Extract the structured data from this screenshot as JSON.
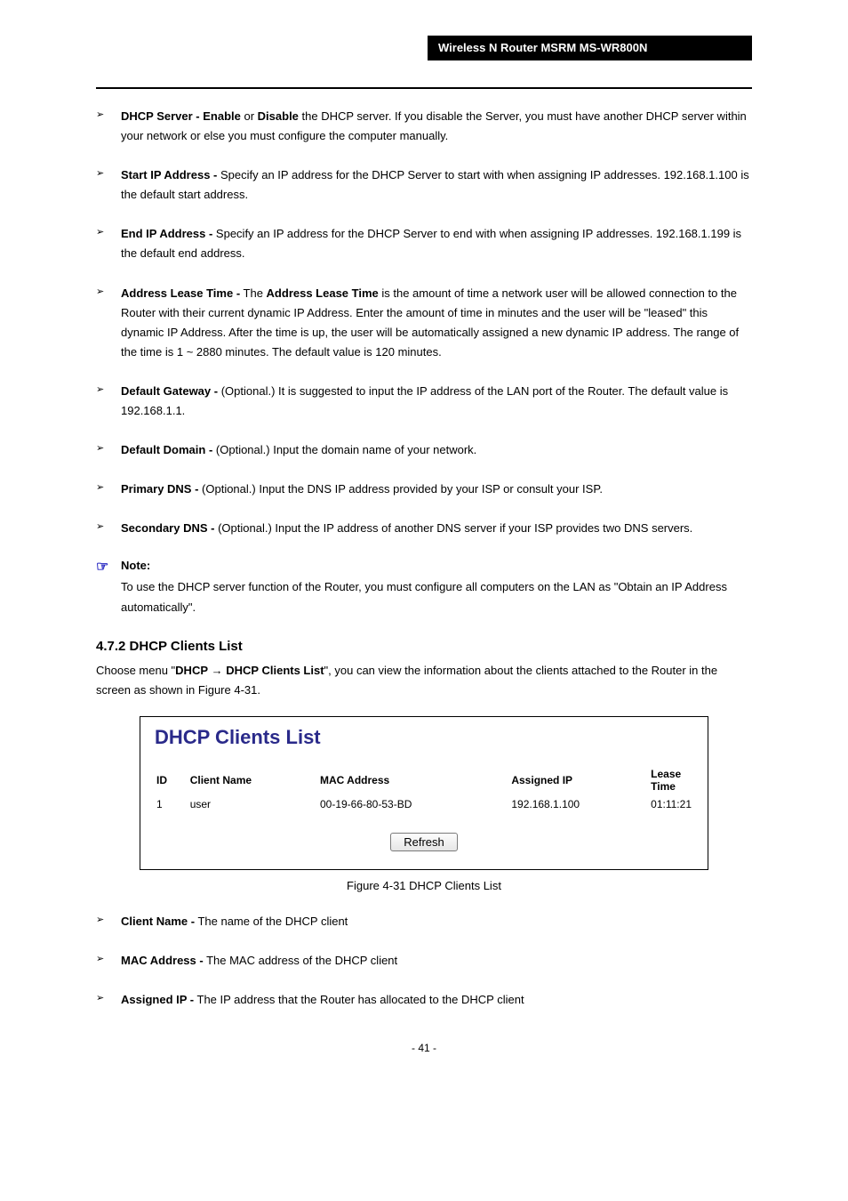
{
  "header": {
    "product": "Wireless N Router MSRM MS-WR800N",
    "page_number": "- 41 -"
  },
  "dhcp_settings": {
    "items": [
      {
        "term": "DHCP Server - Enable",
        "term_suffix": " or ",
        "term2": "Disable",
        "desc": " the DHCP server. If you disable the Server, you must have another DHCP server within your network or else you must configure the computer manually."
      },
      {
        "term": "Start IP Address -",
        "desc": " Specify an IP address for the DHCP Server to start with when assigning IP addresses. 192.168.1.100 is the default start address."
      },
      {
        "term": "End IP Address -",
        "desc": " Specify an IP address for the DHCP Server to end with when assigning IP addresses. 192.168.1.199 is the default end address."
      },
      {
        "term": "Address Lease Time -",
        "desc": " The ",
        "term_inner": "Address Lease Time",
        "desc2": " is the amount of time a network user will be allowed connection to the Router with their current dynamic IP Address. Enter the amount of time in minutes and the user will be \"leased\" this dynamic IP Address. After the time is up, the user will be automatically assigned a new dynamic IP address. The range of the time is 1 ~ 2880 minutes. The default value is 120 minutes."
      },
      {
        "term": "Default Gateway -",
        "desc": " (Optional.) It is suggested to input the IP address of the LAN port of the Router. The default value is 192.168.1.1."
      },
      {
        "term": "Default Domain -",
        "desc": " (Optional.) Input the domain name of your network."
      },
      {
        "term": "Primary DNS -",
        "desc": " (Optional.) Input the DNS IP address provided by your ISP or consult your ISP."
      },
      {
        "term": "Secondary DNS -",
        "desc": " (Optional.) Input the IP address of another DNS server if your ISP provides two DNS servers."
      }
    ],
    "note_label": "Note:",
    "note_text": "To use the DHCP server function of the Router, you must configure all computers on the LAN as \"Obtain an IP Address automatically\"."
  },
  "section2": {
    "heading": "4.7.2 DHCP Clients List",
    "intro_pre": "Choose menu \"",
    "intro_menu1": "DHCP",
    "intro_menu2": "DHCP Clients List",
    "intro_post": "\", you can view the information about the clients attached to the Router in the screen as shown in Figure 4-31."
  },
  "figure": {
    "title": "DHCP Clients List",
    "headers": {
      "id": "ID",
      "name": "Client Name",
      "mac": "MAC Address",
      "ip": "Assigned IP",
      "lease": "Lease Time"
    },
    "rows": [
      {
        "id": "1",
        "name": "user",
        "mac": "00-19-66-80-53-BD",
        "ip": "192.168.1.100",
        "lease": "01:11:21"
      }
    ],
    "refresh_label": "Refresh",
    "caption": "Figure 4-31 DHCP Clients List"
  },
  "client_fields": [
    {
      "term": "Client Name -",
      "desc": " The name of the DHCP client"
    },
    {
      "term": "MAC Address -",
      "desc": " The MAC address of the DHCP client"
    },
    {
      "term": "Assigned IP -",
      "desc": " The IP address that the Router has allocated to the DHCP client"
    }
  ]
}
